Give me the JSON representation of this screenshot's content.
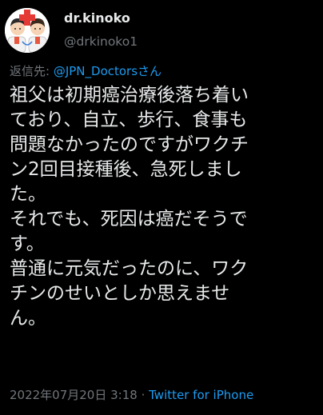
{
  "author": {
    "display_name": "dr.kinoko",
    "handle": "@drkinoko1"
  },
  "reply": {
    "prefix": "返信先: ",
    "mention": "@JPN_Doctorsさん"
  },
  "tweet": {
    "lines": [
      "祖父は初期癌治療後落ち着い",
      "ており、自立、歩行、食事も",
      "問題なかったのですがワクチ",
      "ン2回目接種後、急死しまし",
      "た。",
      "それでも、死因は癌だそうで",
      "す。",
      "普通に元気だったのに、ワク",
      "チンのせいとしか思えませ",
      "ん。"
    ]
  },
  "meta": {
    "timestamp": "2022年07月20日 3:18",
    "separator": " · ",
    "source": "Twitter for iPhone"
  },
  "colors": {
    "background": "#000000",
    "text": "#e7e9ea",
    "secondary": "#71767b",
    "link": "#1d9bf0"
  },
  "icons": {
    "avatar": "doctors-illustration-avatar"
  }
}
